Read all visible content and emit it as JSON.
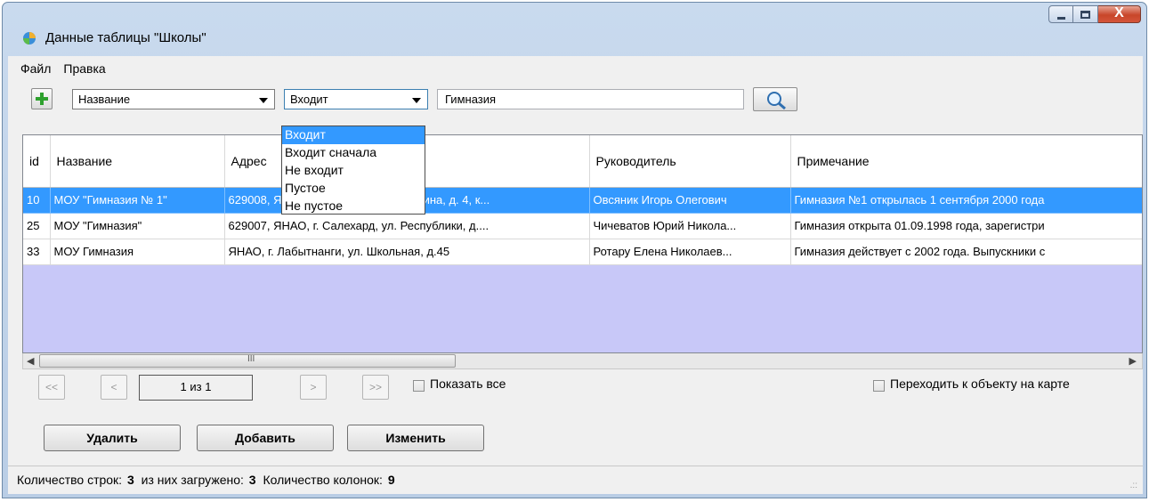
{
  "window": {
    "title": "Данные таблицы \"Школы\"",
    "close_glyph": "X"
  },
  "menu": [
    "Файл",
    "Правка"
  ],
  "filter": {
    "field": "Название",
    "operator": "Входит",
    "value": "Гимназия",
    "operator_options": [
      "Входит",
      "Входит сначала",
      "Не входит",
      "Пустое",
      "Не пустое"
    ],
    "operator_highlighted": 0
  },
  "table": {
    "columns": [
      "id",
      "Название",
      "Адрес",
      "Руководитель",
      "Примечание"
    ],
    "rows": [
      [
        "10",
        "МОУ \"Гимназия № 1\"",
        "629008, ЯНАО, г. Салехард, ул. Губкина, д. 4, к...",
        "Овсяник Игорь Олегович",
        "Гимназия №1 открылась 1 сентября 2000 года"
      ],
      [
        "25",
        "МОУ \"Гимназия\"",
        "629007, ЯНАО, г. Салехард, ул. Республики, д....",
        "Чичеватов Юрий Никола...",
        "Гимназия открыта 01.09.1998 года, зарегистри"
      ],
      [
        "33",
        "МОУ  Гимназия",
        "ЯНАО, г. Лабытнанги, ул. Школьная, д.45",
        "Ротару  Елена Николаев...",
        "Гимназия действует с 2002 года. Выпускники с"
      ]
    ],
    "selected_row": 0,
    "scroll_grip": "III"
  },
  "pager": {
    "first": "<<",
    "prev": "<",
    "page_text": "1 из 1",
    "next": ">",
    "last": ">>",
    "show_all_label": "Показать все",
    "show_all_checked": false,
    "goto_map_label": "Переходить к объекту на карте",
    "goto_map_checked": false
  },
  "actions": {
    "delete": "Удалить",
    "add": "Добавить",
    "edit": "Изменить"
  },
  "status": {
    "rows_label": "Количество строк:",
    "rows_value": "3",
    "loaded_label": "из них загружено:",
    "loaded_value": "3",
    "cols_label": "Количество колонок:",
    "cols_value": "9"
  },
  "colors": {
    "selection": "#3399ff",
    "grid_empty": "#c8c8f8",
    "title_bar": "#c9daee",
    "close_button": "#c8462a"
  }
}
